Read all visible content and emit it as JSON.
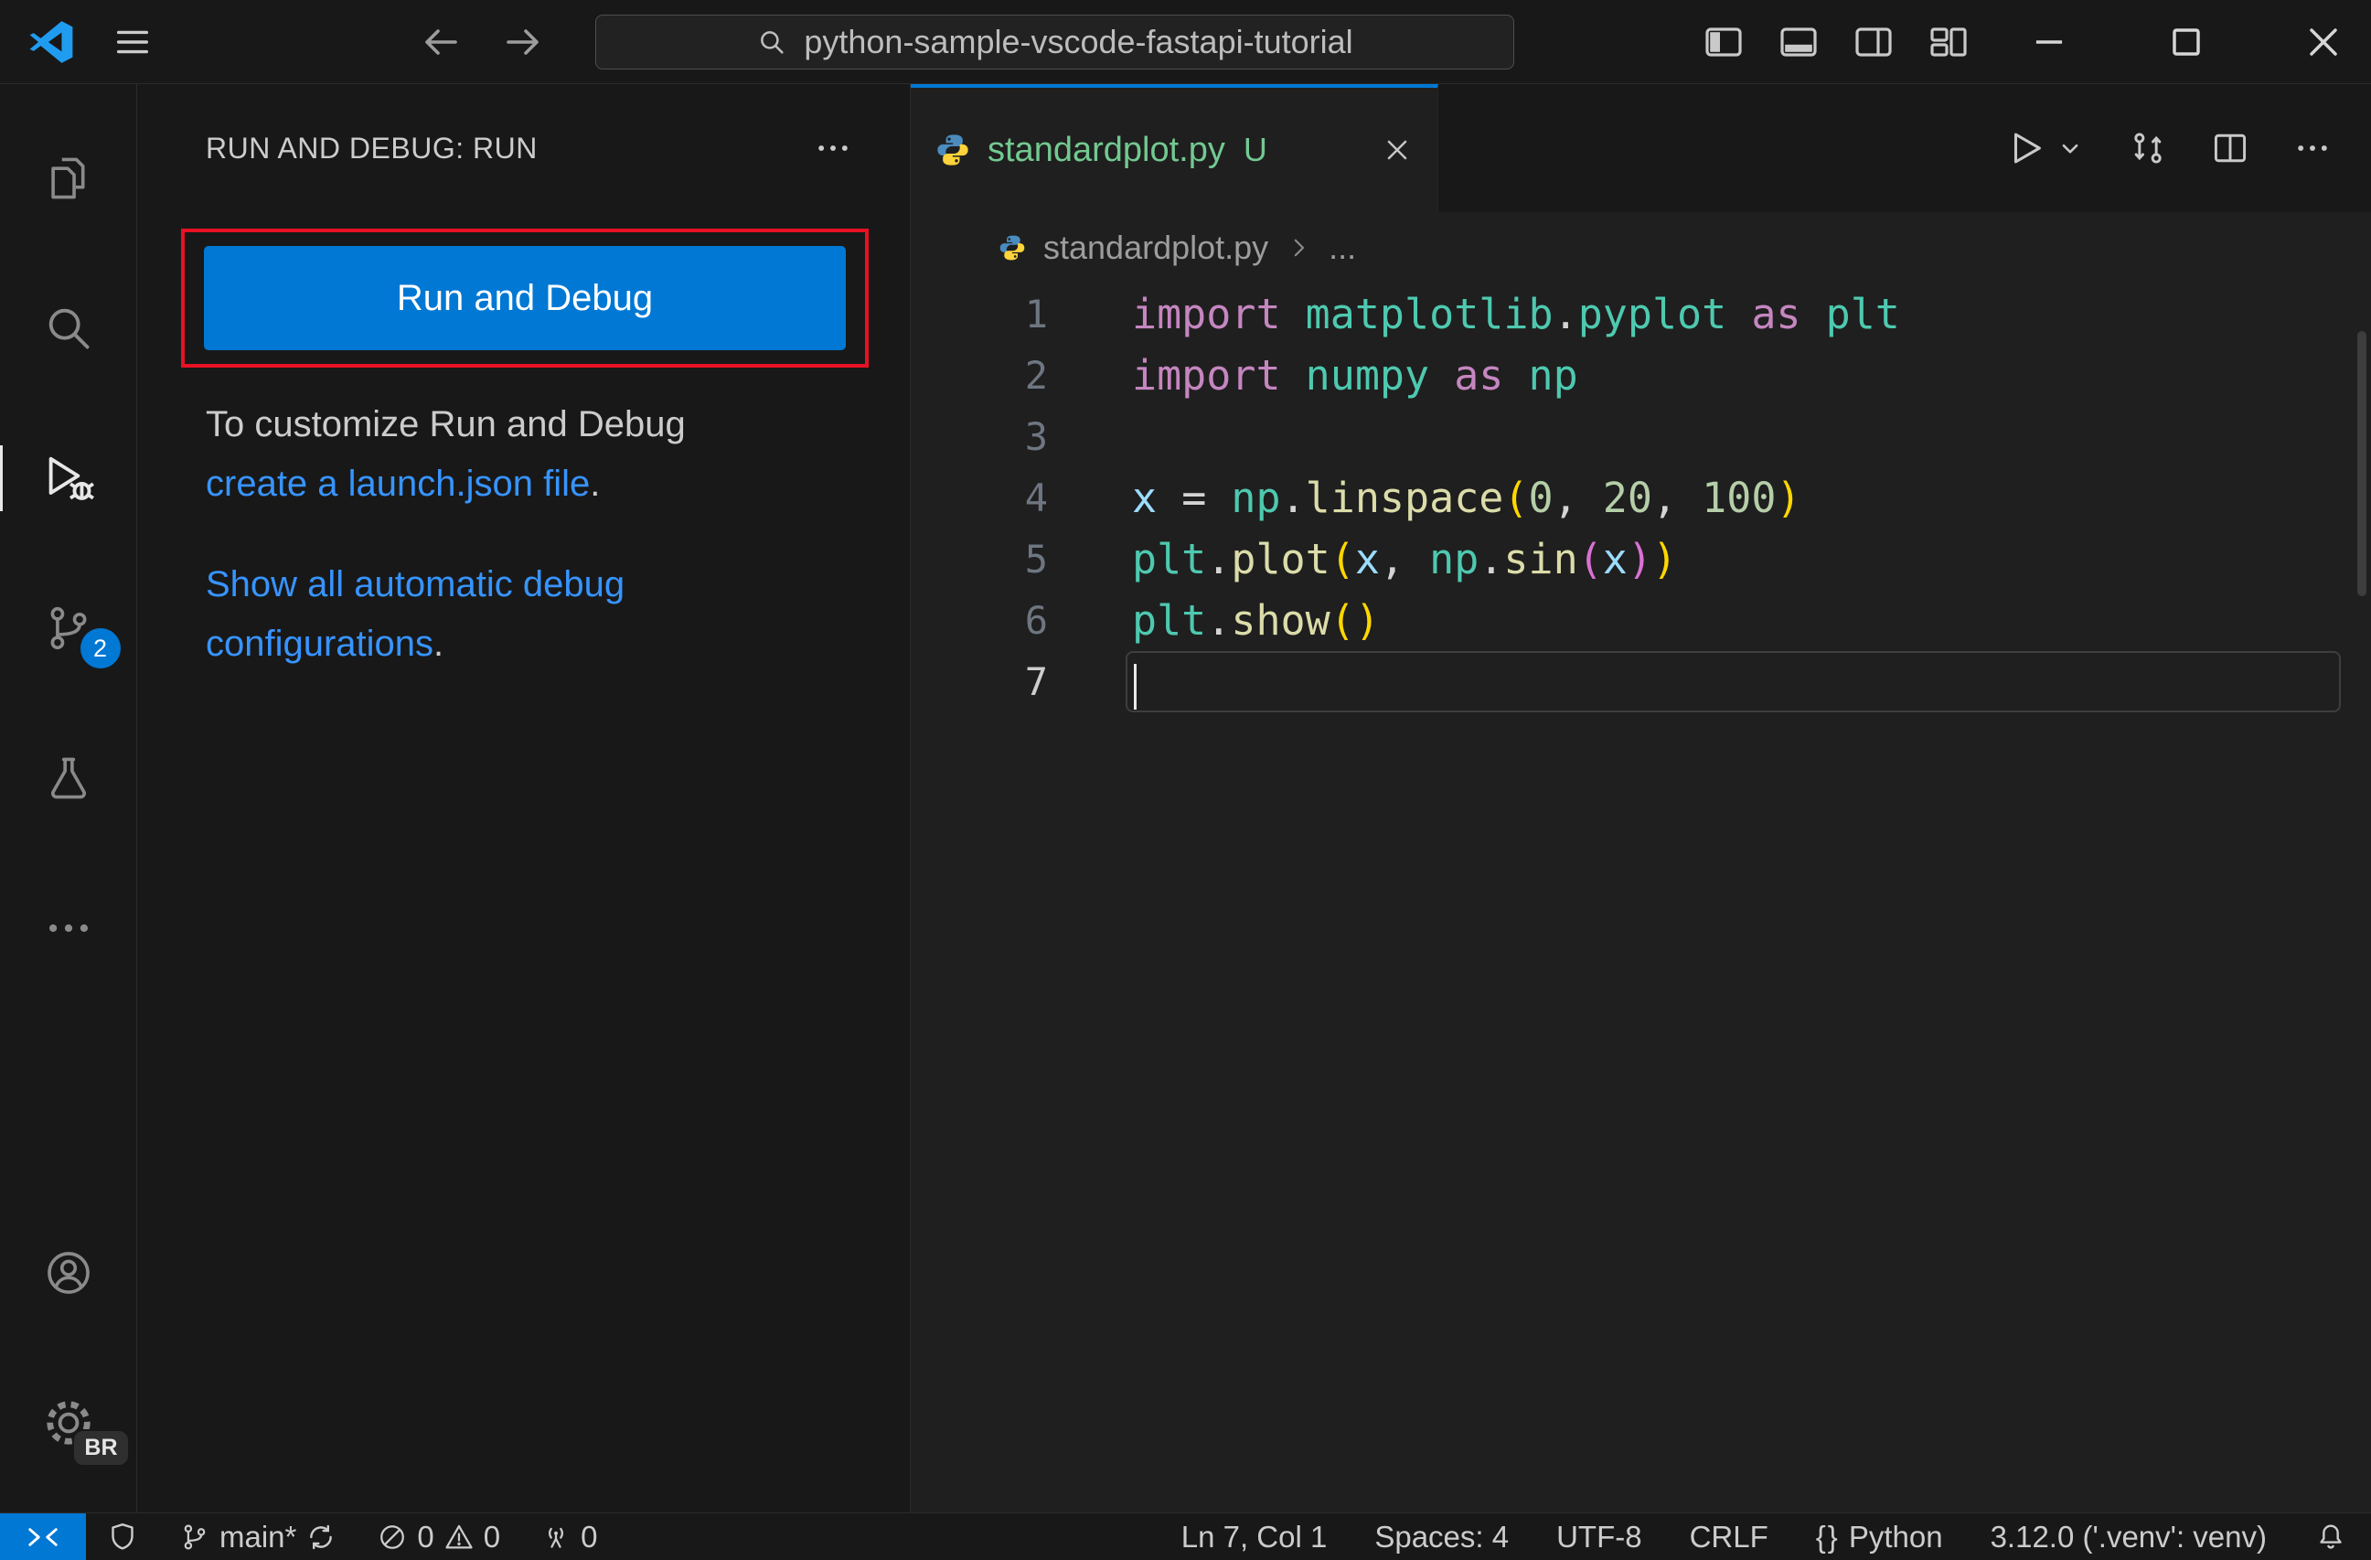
{
  "titlebar": {
    "search_text": "python-sample-vscode-fastapi-tutorial"
  },
  "activity_bar": {
    "source_control_badge": "2",
    "profile_badge": "BR"
  },
  "sidebar": {
    "header_title": "RUN AND DEBUG: RUN",
    "run_button": "Run and Debug",
    "customize_prefix": "To customize Run and Debug",
    "launch_link": "create a launch.json file",
    "launch_suffix": ".",
    "configs_link": "Show all automatic debug configurations",
    "configs_suffix": "."
  },
  "editor": {
    "tab_label": "standardplot.py",
    "tab_git_status": "U",
    "breadcrumb_file": "standardplot.py",
    "breadcrumb_more": "...",
    "code_lines": [
      {
        "num": "1",
        "tokens": [
          [
            "import ",
            "kw"
          ],
          [
            "matplotlib",
            "mod"
          ],
          [
            ".",
            "pl"
          ],
          [
            "pyplot",
            "mod"
          ],
          [
            " ",
            "pl"
          ],
          [
            "as",
            "kw"
          ],
          [
            " ",
            "pl"
          ],
          [
            "plt",
            "mod"
          ]
        ]
      },
      {
        "num": "2",
        "tokens": [
          [
            "import ",
            "kw"
          ],
          [
            "numpy",
            "mod"
          ],
          [
            " ",
            "pl"
          ],
          [
            "as",
            "kw"
          ],
          [
            " ",
            "pl"
          ],
          [
            "np",
            "mod"
          ]
        ]
      },
      {
        "num": "3",
        "tokens": []
      },
      {
        "num": "4",
        "tokens": [
          [
            "x",
            "var"
          ],
          [
            " ",
            "pl"
          ],
          [
            "=",
            "pl"
          ],
          [
            " ",
            "pl"
          ],
          [
            "np",
            "mod"
          ],
          [
            ".",
            "pl"
          ],
          [
            "linspace",
            "fn"
          ],
          [
            "(",
            "b1"
          ],
          [
            "0",
            "num"
          ],
          [
            ",",
            "pl"
          ],
          [
            " ",
            "pl"
          ],
          [
            "20",
            "num"
          ],
          [
            ",",
            "pl"
          ],
          [
            " ",
            "pl"
          ],
          [
            "100",
            "num"
          ],
          [
            ")",
            "b1"
          ]
        ]
      },
      {
        "num": "5",
        "tokens": [
          [
            "plt",
            "mod"
          ],
          [
            ".",
            "pl"
          ],
          [
            "plot",
            "fn"
          ],
          [
            "(",
            "b1"
          ],
          [
            "x",
            "var"
          ],
          [
            ",",
            "pl"
          ],
          [
            " ",
            "pl"
          ],
          [
            "np",
            "mod"
          ],
          [
            ".",
            "pl"
          ],
          [
            "sin",
            "fn"
          ],
          [
            "(",
            "b2"
          ],
          [
            "x",
            "var"
          ],
          [
            ")",
            "b2"
          ],
          [
            ")",
            "b1"
          ]
        ]
      },
      {
        "num": "6",
        "tokens": [
          [
            "plt",
            "mod"
          ],
          [
            ".",
            "pl"
          ],
          [
            "show",
            "fn"
          ],
          [
            "(",
            "b1"
          ],
          [
            ")",
            "b1"
          ]
        ]
      },
      {
        "num": "7",
        "tokens": [],
        "cursor": true
      }
    ]
  },
  "status_bar": {
    "branch": "main*",
    "errors": "0",
    "warnings": "0",
    "ports": "0",
    "cursor_position": "Ln 7, Col 1",
    "indentation": "Spaces: 4",
    "encoding": "UTF-8",
    "eol": "CRLF",
    "language_braces": "{}",
    "language": "Python",
    "interpreter": "3.12.0 ('.venv': venv)"
  },
  "colors": {
    "accent_blue": "#0078d4",
    "link_blue": "#3794ff",
    "annotation_red": "#e81123",
    "git_untracked_green": "#73C991",
    "syntax": {
      "keyword": "#C586C0",
      "module": "#4EC9B0",
      "variable": "#9CDCFE",
      "function": "#DCDCAA",
      "number": "#B5CEA8",
      "plain": "#D4D4D4",
      "bracket_level1": "#FFD700",
      "bracket_level2": "#DA70D6"
    }
  },
  "icons": [
    "vscode-logo-icon",
    "menu-icon",
    "arrow-back-icon",
    "arrow-forward-icon",
    "search-icon",
    "layout-sidebar-left-icon",
    "layout-panel-icon",
    "layout-sidebar-right-icon",
    "layout-customize-icon",
    "minimize-icon",
    "maximize-icon",
    "close-icon",
    "explorer-icon",
    "run-and-debug-icon",
    "source-control-icon",
    "testing-icon",
    "more-views-icon",
    "account-icon",
    "settings-gear-icon",
    "ellipsis-icon",
    "python-file-icon",
    "chevron-right-icon",
    "run-icon",
    "chevron-down-icon",
    "open-changes-icon",
    "split-editor-icon",
    "more-actions-icon",
    "remote-icon",
    "shield-icon",
    "git-branch-icon",
    "sync-icon",
    "error-icon",
    "warning-icon",
    "radio-tower-icon",
    "bell-icon"
  ]
}
